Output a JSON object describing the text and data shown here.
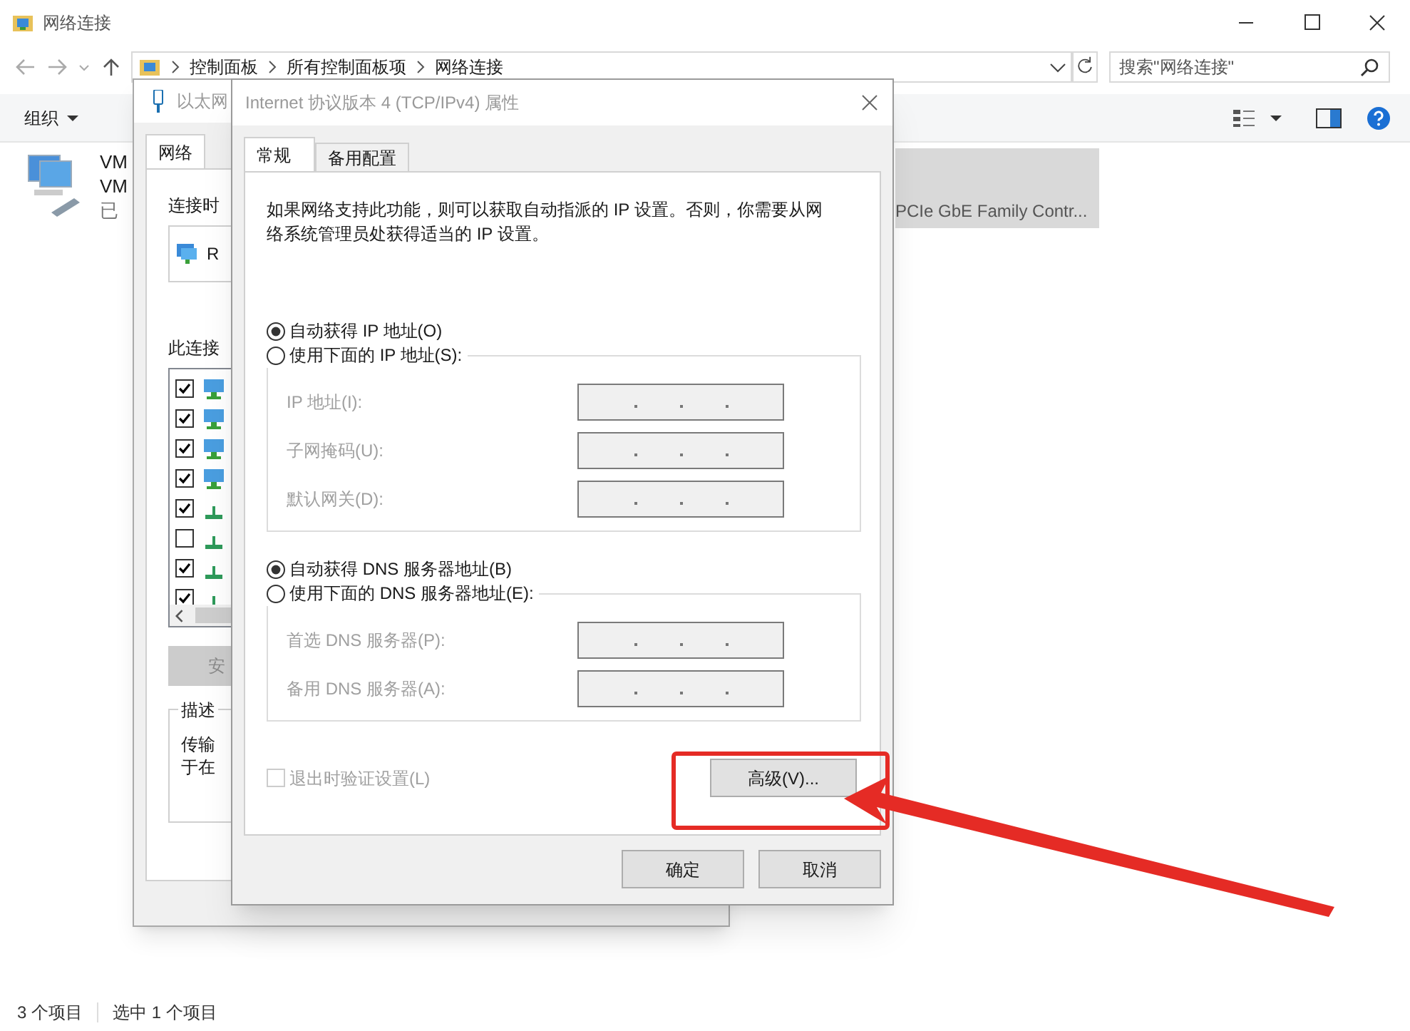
{
  "window": {
    "title": "网络连接"
  },
  "address_bar": {
    "path": [
      "控制面板",
      "所有控制面板项",
      "网络连接"
    ]
  },
  "search": {
    "placeholder": "搜索\"网络连接\""
  },
  "toolbar": {
    "items": [
      "组织"
    ]
  },
  "items": [
    {
      "lines": [
        "VM",
        "VM",
        "已"
      ],
      "selected": false
    },
    {
      "lines": [
        "PCIe GbE Family Contr..."
      ],
      "selected": true
    }
  ],
  "status_bar": [
    "3 个项目",
    "选中 1 个项目"
  ],
  "ethernet_dialog": {
    "title": "以太网",
    "tabs": [
      {
        "label": "网络",
        "selected": true
      }
    ],
    "connect_label": "连接时",
    "adapter": "R",
    "components_label": "此连接",
    "components": [
      {
        "checked": true,
        "kind": "client"
      },
      {
        "checked": true,
        "kind": "client"
      },
      {
        "checked": true,
        "kind": "client"
      },
      {
        "checked": true,
        "kind": "client"
      },
      {
        "checked": true,
        "kind": "protocol"
      },
      {
        "checked": false,
        "kind": "protocol"
      },
      {
        "checked": true,
        "kind": "protocol"
      },
      {
        "checked": true,
        "kind": "protocol"
      }
    ],
    "install_button": "安",
    "description": {
      "title": "描述",
      "lines": [
        "传输",
        "于在"
      ]
    }
  },
  "ipv4_dialog": {
    "title": "Internet 协议版本 4 (TCP/IPv4) 属性",
    "tabs": [
      {
        "label": "常规",
        "selected": true
      },
      {
        "label": "备用配置",
        "selected": false
      }
    ],
    "intro": "如果网络支持此功能，则可以获取自动指派的 IP 设置。否则，你需要从网络系统管理员处获得适当的 IP 设置。",
    "ip_options": [
      {
        "label": "自动获得 IP 地址(O)",
        "selected": true
      },
      {
        "label": "使用下面的 IP 地址(S):",
        "selected": false
      }
    ],
    "ip_fields": [
      {
        "label": "IP 地址(I):",
        "disabled": true
      },
      {
        "label": "子网掩码(U):",
        "disabled": true
      },
      {
        "label": "默认网关(D):",
        "disabled": true
      }
    ],
    "dns_options": [
      {
        "label": "自动获得 DNS 服务器地址(B)",
        "selected": true
      },
      {
        "label": "使用下面的 DNS 服务器地址(E):",
        "selected": false
      }
    ],
    "dns_fields": [
      {
        "label": "首选 DNS 服务器(P):",
        "disabled": true
      },
      {
        "label": "备用 DNS 服务器(A):",
        "disabled": true
      }
    ],
    "validate": {
      "label": "退出时验证设置(L)",
      "checked": false,
      "disabled": true
    },
    "advanced_button": "高级(V)...",
    "buttons": [
      "确定",
      "取消"
    ]
  }
}
